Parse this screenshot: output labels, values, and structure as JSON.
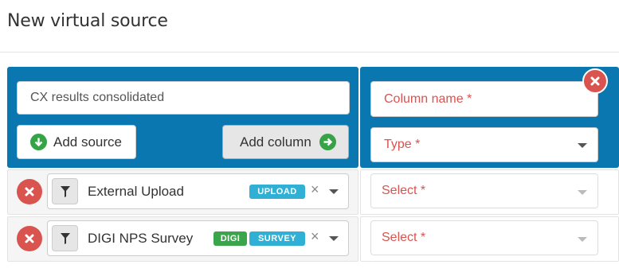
{
  "header": {
    "title": "New virtual source"
  },
  "source_panel": {
    "name_value": "CX results consolidated",
    "add_source_label": "Add source",
    "add_column_label": "Add column"
  },
  "column_panel": {
    "name_placeholder": "Column name *",
    "type_placeholder": "Type *"
  },
  "rows": [
    {
      "label": "External Upload",
      "badges": [
        "UPLOAD"
      ],
      "select_placeholder": "Select *"
    },
    {
      "label": "DIGI NPS Survey",
      "badges": [
        "DIGI",
        "SURVEY"
      ],
      "select_placeholder": "Select *"
    }
  ],
  "colors": {
    "panel": "#0b77b0",
    "danger": "#d9534f",
    "success": "#37a347",
    "info": "#31b0d5"
  }
}
